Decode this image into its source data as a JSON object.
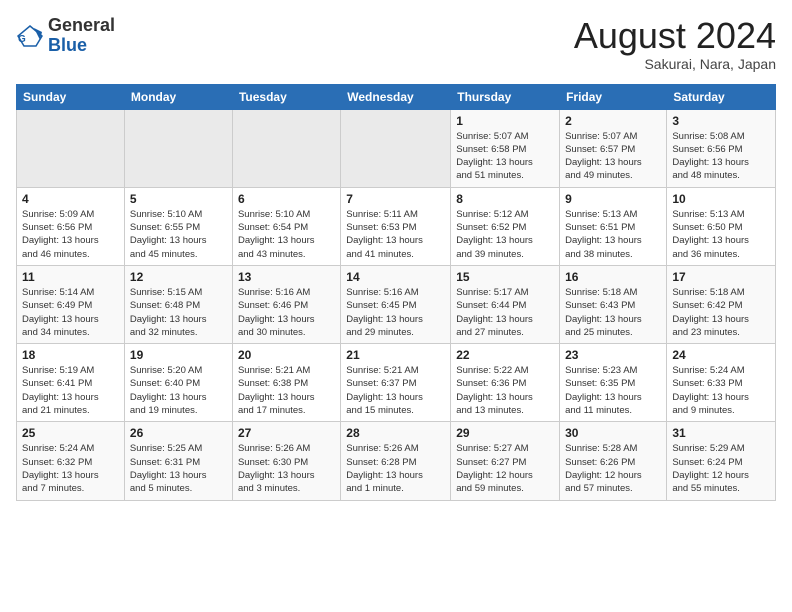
{
  "header": {
    "logo_general": "General",
    "logo_blue": "Blue",
    "month_title": "August 2024",
    "subtitle": "Sakurai, Nara, Japan"
  },
  "weekdays": [
    "Sunday",
    "Monday",
    "Tuesday",
    "Wednesday",
    "Thursday",
    "Friday",
    "Saturday"
  ],
  "weeks": [
    [
      {
        "day": "",
        "info": ""
      },
      {
        "day": "",
        "info": ""
      },
      {
        "day": "",
        "info": ""
      },
      {
        "day": "",
        "info": ""
      },
      {
        "day": "1",
        "info": "Sunrise: 5:07 AM\nSunset: 6:58 PM\nDaylight: 13 hours\nand 51 minutes."
      },
      {
        "day": "2",
        "info": "Sunrise: 5:07 AM\nSunset: 6:57 PM\nDaylight: 13 hours\nand 49 minutes."
      },
      {
        "day": "3",
        "info": "Sunrise: 5:08 AM\nSunset: 6:56 PM\nDaylight: 13 hours\nand 48 minutes."
      }
    ],
    [
      {
        "day": "4",
        "info": "Sunrise: 5:09 AM\nSunset: 6:56 PM\nDaylight: 13 hours\nand 46 minutes."
      },
      {
        "day": "5",
        "info": "Sunrise: 5:10 AM\nSunset: 6:55 PM\nDaylight: 13 hours\nand 45 minutes."
      },
      {
        "day": "6",
        "info": "Sunrise: 5:10 AM\nSunset: 6:54 PM\nDaylight: 13 hours\nand 43 minutes."
      },
      {
        "day": "7",
        "info": "Sunrise: 5:11 AM\nSunset: 6:53 PM\nDaylight: 13 hours\nand 41 minutes."
      },
      {
        "day": "8",
        "info": "Sunrise: 5:12 AM\nSunset: 6:52 PM\nDaylight: 13 hours\nand 39 minutes."
      },
      {
        "day": "9",
        "info": "Sunrise: 5:13 AM\nSunset: 6:51 PM\nDaylight: 13 hours\nand 38 minutes."
      },
      {
        "day": "10",
        "info": "Sunrise: 5:13 AM\nSunset: 6:50 PM\nDaylight: 13 hours\nand 36 minutes."
      }
    ],
    [
      {
        "day": "11",
        "info": "Sunrise: 5:14 AM\nSunset: 6:49 PM\nDaylight: 13 hours\nand 34 minutes."
      },
      {
        "day": "12",
        "info": "Sunrise: 5:15 AM\nSunset: 6:48 PM\nDaylight: 13 hours\nand 32 minutes."
      },
      {
        "day": "13",
        "info": "Sunrise: 5:16 AM\nSunset: 6:46 PM\nDaylight: 13 hours\nand 30 minutes."
      },
      {
        "day": "14",
        "info": "Sunrise: 5:16 AM\nSunset: 6:45 PM\nDaylight: 13 hours\nand 29 minutes."
      },
      {
        "day": "15",
        "info": "Sunrise: 5:17 AM\nSunset: 6:44 PM\nDaylight: 13 hours\nand 27 minutes."
      },
      {
        "day": "16",
        "info": "Sunrise: 5:18 AM\nSunset: 6:43 PM\nDaylight: 13 hours\nand 25 minutes."
      },
      {
        "day": "17",
        "info": "Sunrise: 5:18 AM\nSunset: 6:42 PM\nDaylight: 13 hours\nand 23 minutes."
      }
    ],
    [
      {
        "day": "18",
        "info": "Sunrise: 5:19 AM\nSunset: 6:41 PM\nDaylight: 13 hours\nand 21 minutes."
      },
      {
        "day": "19",
        "info": "Sunrise: 5:20 AM\nSunset: 6:40 PM\nDaylight: 13 hours\nand 19 minutes."
      },
      {
        "day": "20",
        "info": "Sunrise: 5:21 AM\nSunset: 6:38 PM\nDaylight: 13 hours\nand 17 minutes."
      },
      {
        "day": "21",
        "info": "Sunrise: 5:21 AM\nSunset: 6:37 PM\nDaylight: 13 hours\nand 15 minutes."
      },
      {
        "day": "22",
        "info": "Sunrise: 5:22 AM\nSunset: 6:36 PM\nDaylight: 13 hours\nand 13 minutes."
      },
      {
        "day": "23",
        "info": "Sunrise: 5:23 AM\nSunset: 6:35 PM\nDaylight: 13 hours\nand 11 minutes."
      },
      {
        "day": "24",
        "info": "Sunrise: 5:24 AM\nSunset: 6:33 PM\nDaylight: 13 hours\nand 9 minutes."
      }
    ],
    [
      {
        "day": "25",
        "info": "Sunrise: 5:24 AM\nSunset: 6:32 PM\nDaylight: 13 hours\nand 7 minutes."
      },
      {
        "day": "26",
        "info": "Sunrise: 5:25 AM\nSunset: 6:31 PM\nDaylight: 13 hours\nand 5 minutes."
      },
      {
        "day": "27",
        "info": "Sunrise: 5:26 AM\nSunset: 6:30 PM\nDaylight: 13 hours\nand 3 minutes."
      },
      {
        "day": "28",
        "info": "Sunrise: 5:26 AM\nSunset: 6:28 PM\nDaylight: 13 hours\nand 1 minute."
      },
      {
        "day": "29",
        "info": "Sunrise: 5:27 AM\nSunset: 6:27 PM\nDaylight: 12 hours\nand 59 minutes."
      },
      {
        "day": "30",
        "info": "Sunrise: 5:28 AM\nSunset: 6:26 PM\nDaylight: 12 hours\nand 57 minutes."
      },
      {
        "day": "31",
        "info": "Sunrise: 5:29 AM\nSunset: 6:24 PM\nDaylight: 12 hours\nand 55 minutes."
      }
    ]
  ]
}
